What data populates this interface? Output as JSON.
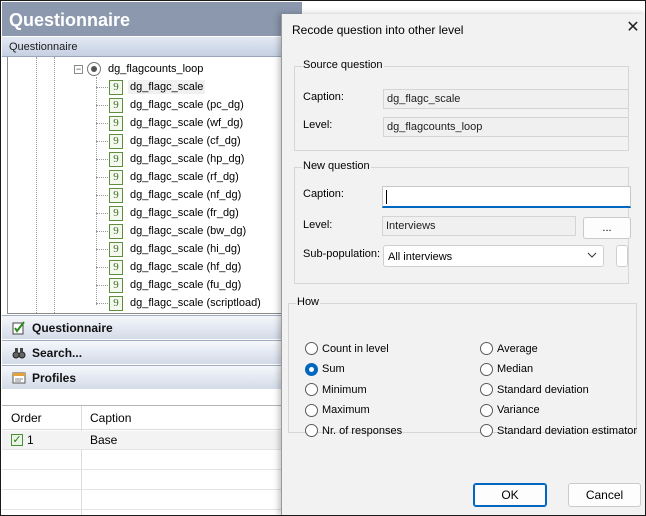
{
  "app": {
    "title": "Questionnaire",
    "panel_header": "Questionnaire"
  },
  "tree": {
    "parent": "dg_flagcounts_loop",
    "items": [
      {
        "label": "dg_flagc_scale",
        "icon": "variable-icon"
      },
      {
        "label": "dg_flagc_scale (pc_dg)",
        "icon": "variable-icon"
      },
      {
        "label": "dg_flagc_scale (wf_dg)",
        "icon": "variable-icon"
      },
      {
        "label": "dg_flagc_scale (cf_dg)",
        "icon": "variable-icon"
      },
      {
        "label": "dg_flagc_scale (hp_dg)",
        "icon": "variable-icon"
      },
      {
        "label": "dg_flagc_scale (rf_dg)",
        "icon": "variable-icon"
      },
      {
        "label": "dg_flagc_scale (nf_dg)",
        "icon": "variable-icon"
      },
      {
        "label": "dg_flagc_scale (fr_dg)",
        "icon": "variable-icon"
      },
      {
        "label": "dg_flagc_scale (bw_dg)",
        "icon": "variable-icon"
      },
      {
        "label": "dg_flagc_scale (hi_dg)",
        "icon": "variable-icon"
      },
      {
        "label": "dg_flagc_scale (hf_dg)",
        "icon": "variable-icon"
      },
      {
        "label": "dg_flagc_scale (fu_dg)",
        "icon": "variable-icon"
      },
      {
        "label": "dg_flagc_scale (scriptload)",
        "icon": "variable-icon"
      }
    ],
    "icon_glyph": "9"
  },
  "nav": {
    "questionnaire": "Questionnaire",
    "search": "Search...",
    "profiles": "Profiles"
  },
  "grid": {
    "col_order": "Order",
    "col_caption": "Caption",
    "rows": [
      {
        "order": "1",
        "caption": "Base"
      }
    ]
  },
  "dialog": {
    "title": "Recode question into other level",
    "close_glyph": "✕",
    "source": {
      "title": "Source question",
      "caption_label": "Caption:",
      "caption_value": "dg_flagc_scale",
      "level_label": "Level:",
      "level_value": "dg_flagcounts_loop"
    },
    "new": {
      "title": "New question",
      "caption_label": "Caption:",
      "caption_value": "",
      "level_label": "Level:",
      "level_value": "Interviews",
      "browse_label": "...",
      "subpop_label": "Sub-population:",
      "subpop_value": "All interviews"
    },
    "how": {
      "title": "How",
      "options_left": [
        "Count in level",
        "Sum",
        "Minimum",
        "Maximum",
        "Nr. of responses"
      ],
      "options_right": [
        "Average",
        "Median",
        "Standard deviation",
        "Variance",
        "Standard deviation estimator"
      ],
      "selected": "Sum"
    },
    "ok_label": "OK",
    "cancel_label": "Cancel"
  },
  "colors": {
    "title_bar": "#8b98ad",
    "accent": "#0067c0",
    "dialog_bg": "#f2f2f2"
  }
}
